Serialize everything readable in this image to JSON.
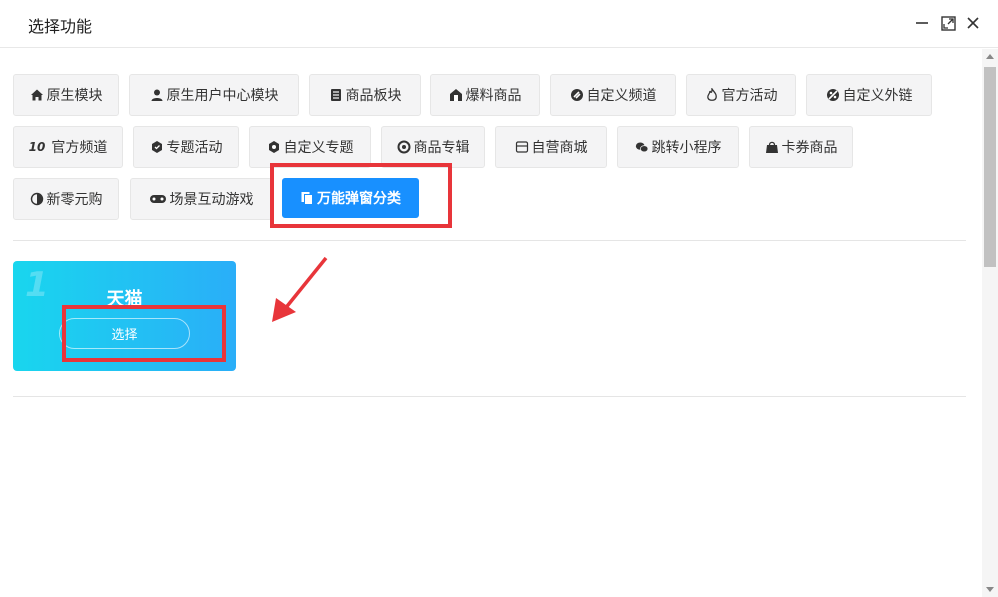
{
  "dialog": {
    "title": "选择功能"
  },
  "toolbar": {
    "buttons": [
      {
        "label": "原生模块",
        "icon": "home-icon"
      },
      {
        "label": "原生用户中心模块",
        "icon": "user-icon"
      },
      {
        "label": "商品板块",
        "icon": "list-icon"
      },
      {
        "label": "爆料商品",
        "icon": "house-icon"
      },
      {
        "label": "自定义频道",
        "icon": "custom-icon"
      },
      {
        "label": "官方活动",
        "icon": "fire-icon"
      },
      {
        "label": "自定义外链",
        "icon": "link-icon"
      },
      {
        "label": "官方频道",
        "icon": "channel-icon"
      },
      {
        "label": "专题活动",
        "icon": "badge-icon"
      },
      {
        "label": "自定义专题",
        "icon": "topic-icon"
      },
      {
        "label": "商品专辑",
        "icon": "album-icon"
      },
      {
        "label": "自营商城",
        "icon": "store-icon"
      },
      {
        "label": "跳转小程序",
        "icon": "wechat-icon"
      },
      {
        "label": "卡券商品",
        "icon": "bag-icon"
      },
      {
        "label": "新零元购",
        "icon": "half-circle-icon"
      },
      {
        "label": "场景互动游戏",
        "icon": "gamepad-icon"
      },
      {
        "label": "万能弹窗分类",
        "icon": "copy-icon",
        "active": true
      }
    ]
  },
  "card": {
    "number": "1",
    "title": "天猫",
    "select_label": "选择"
  },
  "colors": {
    "accent": "#1890ff",
    "highlight": "#e8353a",
    "card_start": "#19d6ee",
    "card_end": "#2aaef8"
  }
}
